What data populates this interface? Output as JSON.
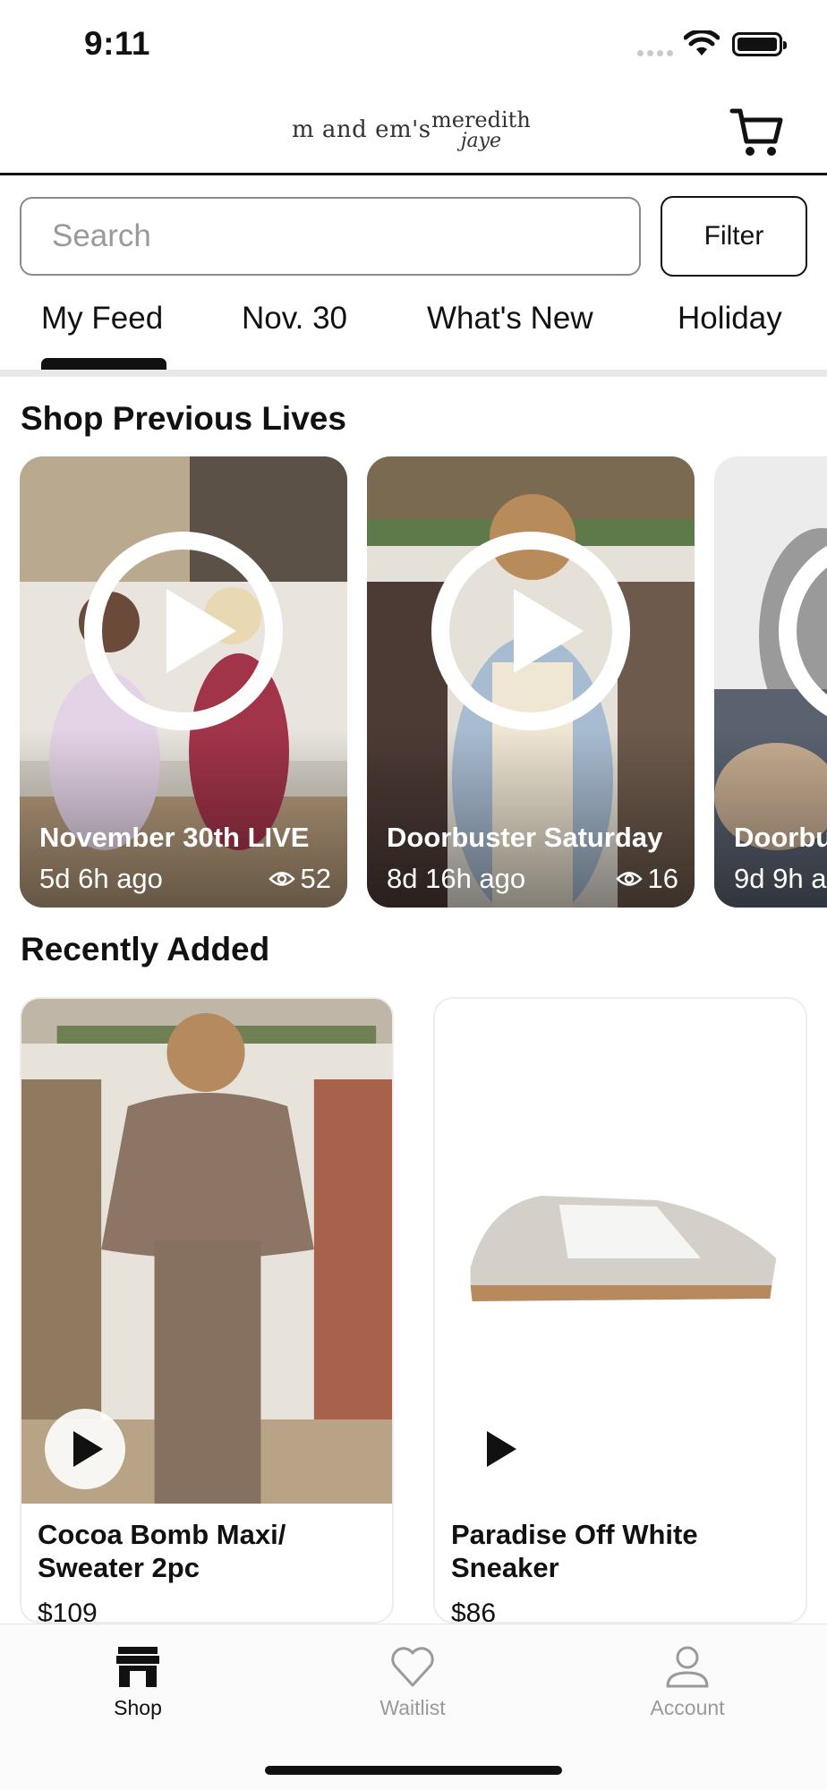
{
  "status_bar": {
    "time": "9:11"
  },
  "header": {
    "brand_1": "m and em's",
    "brand_2_line1": "meredith",
    "brand_2_line2": "jaye",
    "cart_icon": "cart-icon"
  },
  "search": {
    "placeholder": "Search",
    "filter_label": "Filter"
  },
  "tabs": [
    {
      "label": "My Feed",
      "active": true
    },
    {
      "label": "Nov. 30",
      "active": false
    },
    {
      "label": "What's New",
      "active": false
    },
    {
      "label": "Holiday",
      "active": false
    }
  ],
  "previous_lives": {
    "title": "Shop Previous Lives",
    "items": [
      {
        "title": "November 30th LIVE",
        "ago": "5d 6h ago",
        "views": "52"
      },
      {
        "title": "Doorbuster Saturday",
        "ago": "8d 16h ago",
        "views": "16"
      },
      {
        "title": "Doorbu",
        "ago": "9d 9h a",
        "views": ""
      }
    ]
  },
  "recently_added": {
    "title": "Recently Added",
    "items": [
      {
        "name": "Cocoa Bomb Maxi/ Sweater 2pc",
        "price": "$109"
      },
      {
        "name": "Paradise Off White Sneaker",
        "price": "$86"
      }
    ]
  },
  "bottom_nav": [
    {
      "label": "Shop",
      "icon": "store-icon",
      "active": true
    },
    {
      "label": "Waitlist",
      "icon": "heart-icon",
      "active": false
    },
    {
      "label": "Account",
      "icon": "person-icon",
      "active": false
    }
  ],
  "colors": {
    "text": "#111111",
    "inactive": "#9a9a9a",
    "divider": "#e8e8e8"
  }
}
